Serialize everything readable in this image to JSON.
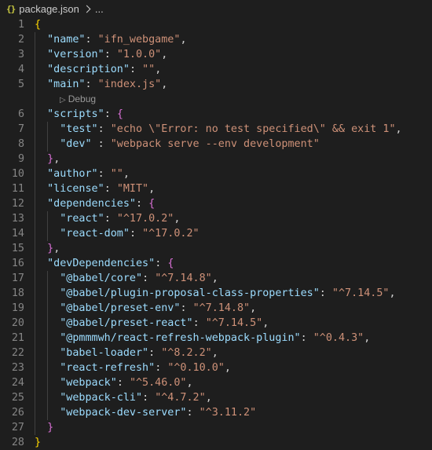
{
  "breadcrumb": {
    "icon_text": "{}",
    "file": "package.json",
    "more": "..."
  },
  "codelens": {
    "icon": "play-icon",
    "label": "Debug"
  },
  "lines": [
    {
      "n": "1",
      "tokens": [
        {
          "t": "{",
          "c": "b1"
        }
      ]
    },
    {
      "n": "2",
      "tokens": [
        {
          "t": "  "
        },
        {
          "t": "\"name\"",
          "c": "k"
        },
        {
          "t": ": ",
          "c": "p"
        },
        {
          "t": "\"ifn_webgame\"",
          "c": "s"
        },
        {
          "t": ",",
          "c": "p"
        }
      ]
    },
    {
      "n": "3",
      "tokens": [
        {
          "t": "  "
        },
        {
          "t": "\"version\"",
          "c": "k"
        },
        {
          "t": ": ",
          "c": "p"
        },
        {
          "t": "\"1.0.0\"",
          "c": "s"
        },
        {
          "t": ",",
          "c": "p"
        }
      ]
    },
    {
      "n": "4",
      "tokens": [
        {
          "t": "  "
        },
        {
          "t": "\"description\"",
          "c": "k"
        },
        {
          "t": ": ",
          "c": "p"
        },
        {
          "t": "\"\"",
          "c": "s"
        },
        {
          "t": ",",
          "c": "p"
        }
      ]
    },
    {
      "n": "5",
      "tokens": [
        {
          "t": "  "
        },
        {
          "t": "\"main\"",
          "c": "k"
        },
        {
          "t": ": ",
          "c": "p"
        },
        {
          "t": "\"index.js\"",
          "c": "s"
        },
        {
          "t": ",",
          "c": "p"
        }
      ]
    },
    {
      "n": "",
      "lens": true,
      "tokens": []
    },
    {
      "n": "6",
      "tokens": [
        {
          "t": "  "
        },
        {
          "t": "\"scripts\"",
          "c": "k"
        },
        {
          "t": ": ",
          "c": "p"
        },
        {
          "t": "{",
          "c": "b2"
        }
      ]
    },
    {
      "n": "7",
      "tokens": [
        {
          "t": "    "
        },
        {
          "t": "\"test\"",
          "c": "k"
        },
        {
          "t": ": ",
          "c": "p"
        },
        {
          "t": "\"echo \\\"Error: no test specified\\\" && exit 1\"",
          "c": "s"
        },
        {
          "t": ",",
          "c": "p"
        }
      ]
    },
    {
      "n": "8",
      "tokens": [
        {
          "t": "    "
        },
        {
          "t": "\"dev\"",
          "c": "k"
        },
        {
          "t": " : ",
          "c": "p"
        },
        {
          "t": "\"webpack serve --env development\"",
          "c": "s"
        }
      ]
    },
    {
      "n": "9",
      "tokens": [
        {
          "t": "  "
        },
        {
          "t": "}",
          "c": "b2"
        },
        {
          "t": ",",
          "c": "p"
        }
      ]
    },
    {
      "n": "10",
      "tokens": [
        {
          "t": "  "
        },
        {
          "t": "\"author\"",
          "c": "k"
        },
        {
          "t": ": ",
          "c": "p"
        },
        {
          "t": "\"\"",
          "c": "s"
        },
        {
          "t": ",",
          "c": "p"
        }
      ]
    },
    {
      "n": "11",
      "tokens": [
        {
          "t": "  "
        },
        {
          "t": "\"license\"",
          "c": "k"
        },
        {
          "t": ": ",
          "c": "p"
        },
        {
          "t": "\"MIT\"",
          "c": "s"
        },
        {
          "t": ",",
          "c": "p"
        }
      ]
    },
    {
      "n": "12",
      "tokens": [
        {
          "t": "  "
        },
        {
          "t": "\"dependencies\"",
          "c": "k"
        },
        {
          "t": ": ",
          "c": "p"
        },
        {
          "t": "{",
          "c": "b2"
        }
      ]
    },
    {
      "n": "13",
      "tokens": [
        {
          "t": "    "
        },
        {
          "t": "\"react\"",
          "c": "k"
        },
        {
          "t": ": ",
          "c": "p"
        },
        {
          "t": "\"^17.0.2\"",
          "c": "s"
        },
        {
          "t": ",",
          "c": "p"
        }
      ]
    },
    {
      "n": "14",
      "tokens": [
        {
          "t": "    "
        },
        {
          "t": "\"react-dom\"",
          "c": "k"
        },
        {
          "t": ": ",
          "c": "p"
        },
        {
          "t": "\"^17.0.2\"",
          "c": "s"
        }
      ]
    },
    {
      "n": "15",
      "tokens": [
        {
          "t": "  "
        },
        {
          "t": "}",
          "c": "b2"
        },
        {
          "t": ",",
          "c": "p"
        }
      ]
    },
    {
      "n": "16",
      "tokens": [
        {
          "t": "  "
        },
        {
          "t": "\"devDependencies\"",
          "c": "k"
        },
        {
          "t": ": ",
          "c": "p"
        },
        {
          "t": "{",
          "c": "b2"
        }
      ]
    },
    {
      "n": "17",
      "tokens": [
        {
          "t": "    "
        },
        {
          "t": "\"@babel/core\"",
          "c": "k"
        },
        {
          "t": ": ",
          "c": "p"
        },
        {
          "t": "\"^7.14.8\"",
          "c": "s"
        },
        {
          "t": ",",
          "c": "p"
        }
      ]
    },
    {
      "n": "18",
      "tokens": [
        {
          "t": "    "
        },
        {
          "t": "\"@babel/plugin-proposal-class-properties\"",
          "c": "k"
        },
        {
          "t": ": ",
          "c": "p"
        },
        {
          "t": "\"^7.14.5\"",
          "c": "s"
        },
        {
          "t": ",",
          "c": "p"
        }
      ]
    },
    {
      "n": "19",
      "tokens": [
        {
          "t": "    "
        },
        {
          "t": "\"@babel/preset-env\"",
          "c": "k"
        },
        {
          "t": ": ",
          "c": "p"
        },
        {
          "t": "\"^7.14.8\"",
          "c": "s"
        },
        {
          "t": ",",
          "c": "p"
        }
      ]
    },
    {
      "n": "20",
      "tokens": [
        {
          "t": "    "
        },
        {
          "t": "\"@babel/preset-react\"",
          "c": "k"
        },
        {
          "t": ": ",
          "c": "p"
        },
        {
          "t": "\"^7.14.5\"",
          "c": "s"
        },
        {
          "t": ",",
          "c": "p"
        }
      ]
    },
    {
      "n": "21",
      "tokens": [
        {
          "t": "    "
        },
        {
          "t": "\"@pmmmwh/react-refresh-webpack-plugin\"",
          "c": "k"
        },
        {
          "t": ": ",
          "c": "p"
        },
        {
          "t": "\"^0.4.3\"",
          "c": "s"
        },
        {
          "t": ",",
          "c": "p"
        }
      ]
    },
    {
      "n": "22",
      "tokens": [
        {
          "t": "    "
        },
        {
          "t": "\"babel-loader\"",
          "c": "k"
        },
        {
          "t": ": ",
          "c": "p"
        },
        {
          "t": "\"^8.2.2\"",
          "c": "s"
        },
        {
          "t": ",",
          "c": "p"
        }
      ]
    },
    {
      "n": "23",
      "tokens": [
        {
          "t": "    "
        },
        {
          "t": "\"react-refresh\"",
          "c": "k"
        },
        {
          "t": ": ",
          "c": "p"
        },
        {
          "t": "\"^0.10.0\"",
          "c": "s"
        },
        {
          "t": ",",
          "c": "p"
        }
      ]
    },
    {
      "n": "24",
      "tokens": [
        {
          "t": "    "
        },
        {
          "t": "\"webpack\"",
          "c": "k"
        },
        {
          "t": ": ",
          "c": "p"
        },
        {
          "t": "\"^5.46.0\"",
          "c": "s"
        },
        {
          "t": ",",
          "c": "p"
        }
      ]
    },
    {
      "n": "25",
      "tokens": [
        {
          "t": "    "
        },
        {
          "t": "\"webpack-cli\"",
          "c": "k"
        },
        {
          "t": ": ",
          "c": "p"
        },
        {
          "t": "\"^4.7.2\"",
          "c": "s"
        },
        {
          "t": ",",
          "c": "p"
        }
      ]
    },
    {
      "n": "26",
      "tokens": [
        {
          "t": "    "
        },
        {
          "t": "\"webpack-dev-server\"",
          "c": "k"
        },
        {
          "t": ": ",
          "c": "p"
        },
        {
          "t": "\"^3.11.2\"",
          "c": "s"
        }
      ]
    },
    {
      "n": "27",
      "tokens": [
        {
          "t": "  "
        },
        {
          "t": "}",
          "c": "b2"
        }
      ]
    },
    {
      "n": "28",
      "tokens": [
        {
          "t": "}",
          "c": "b1"
        }
      ]
    }
  ]
}
